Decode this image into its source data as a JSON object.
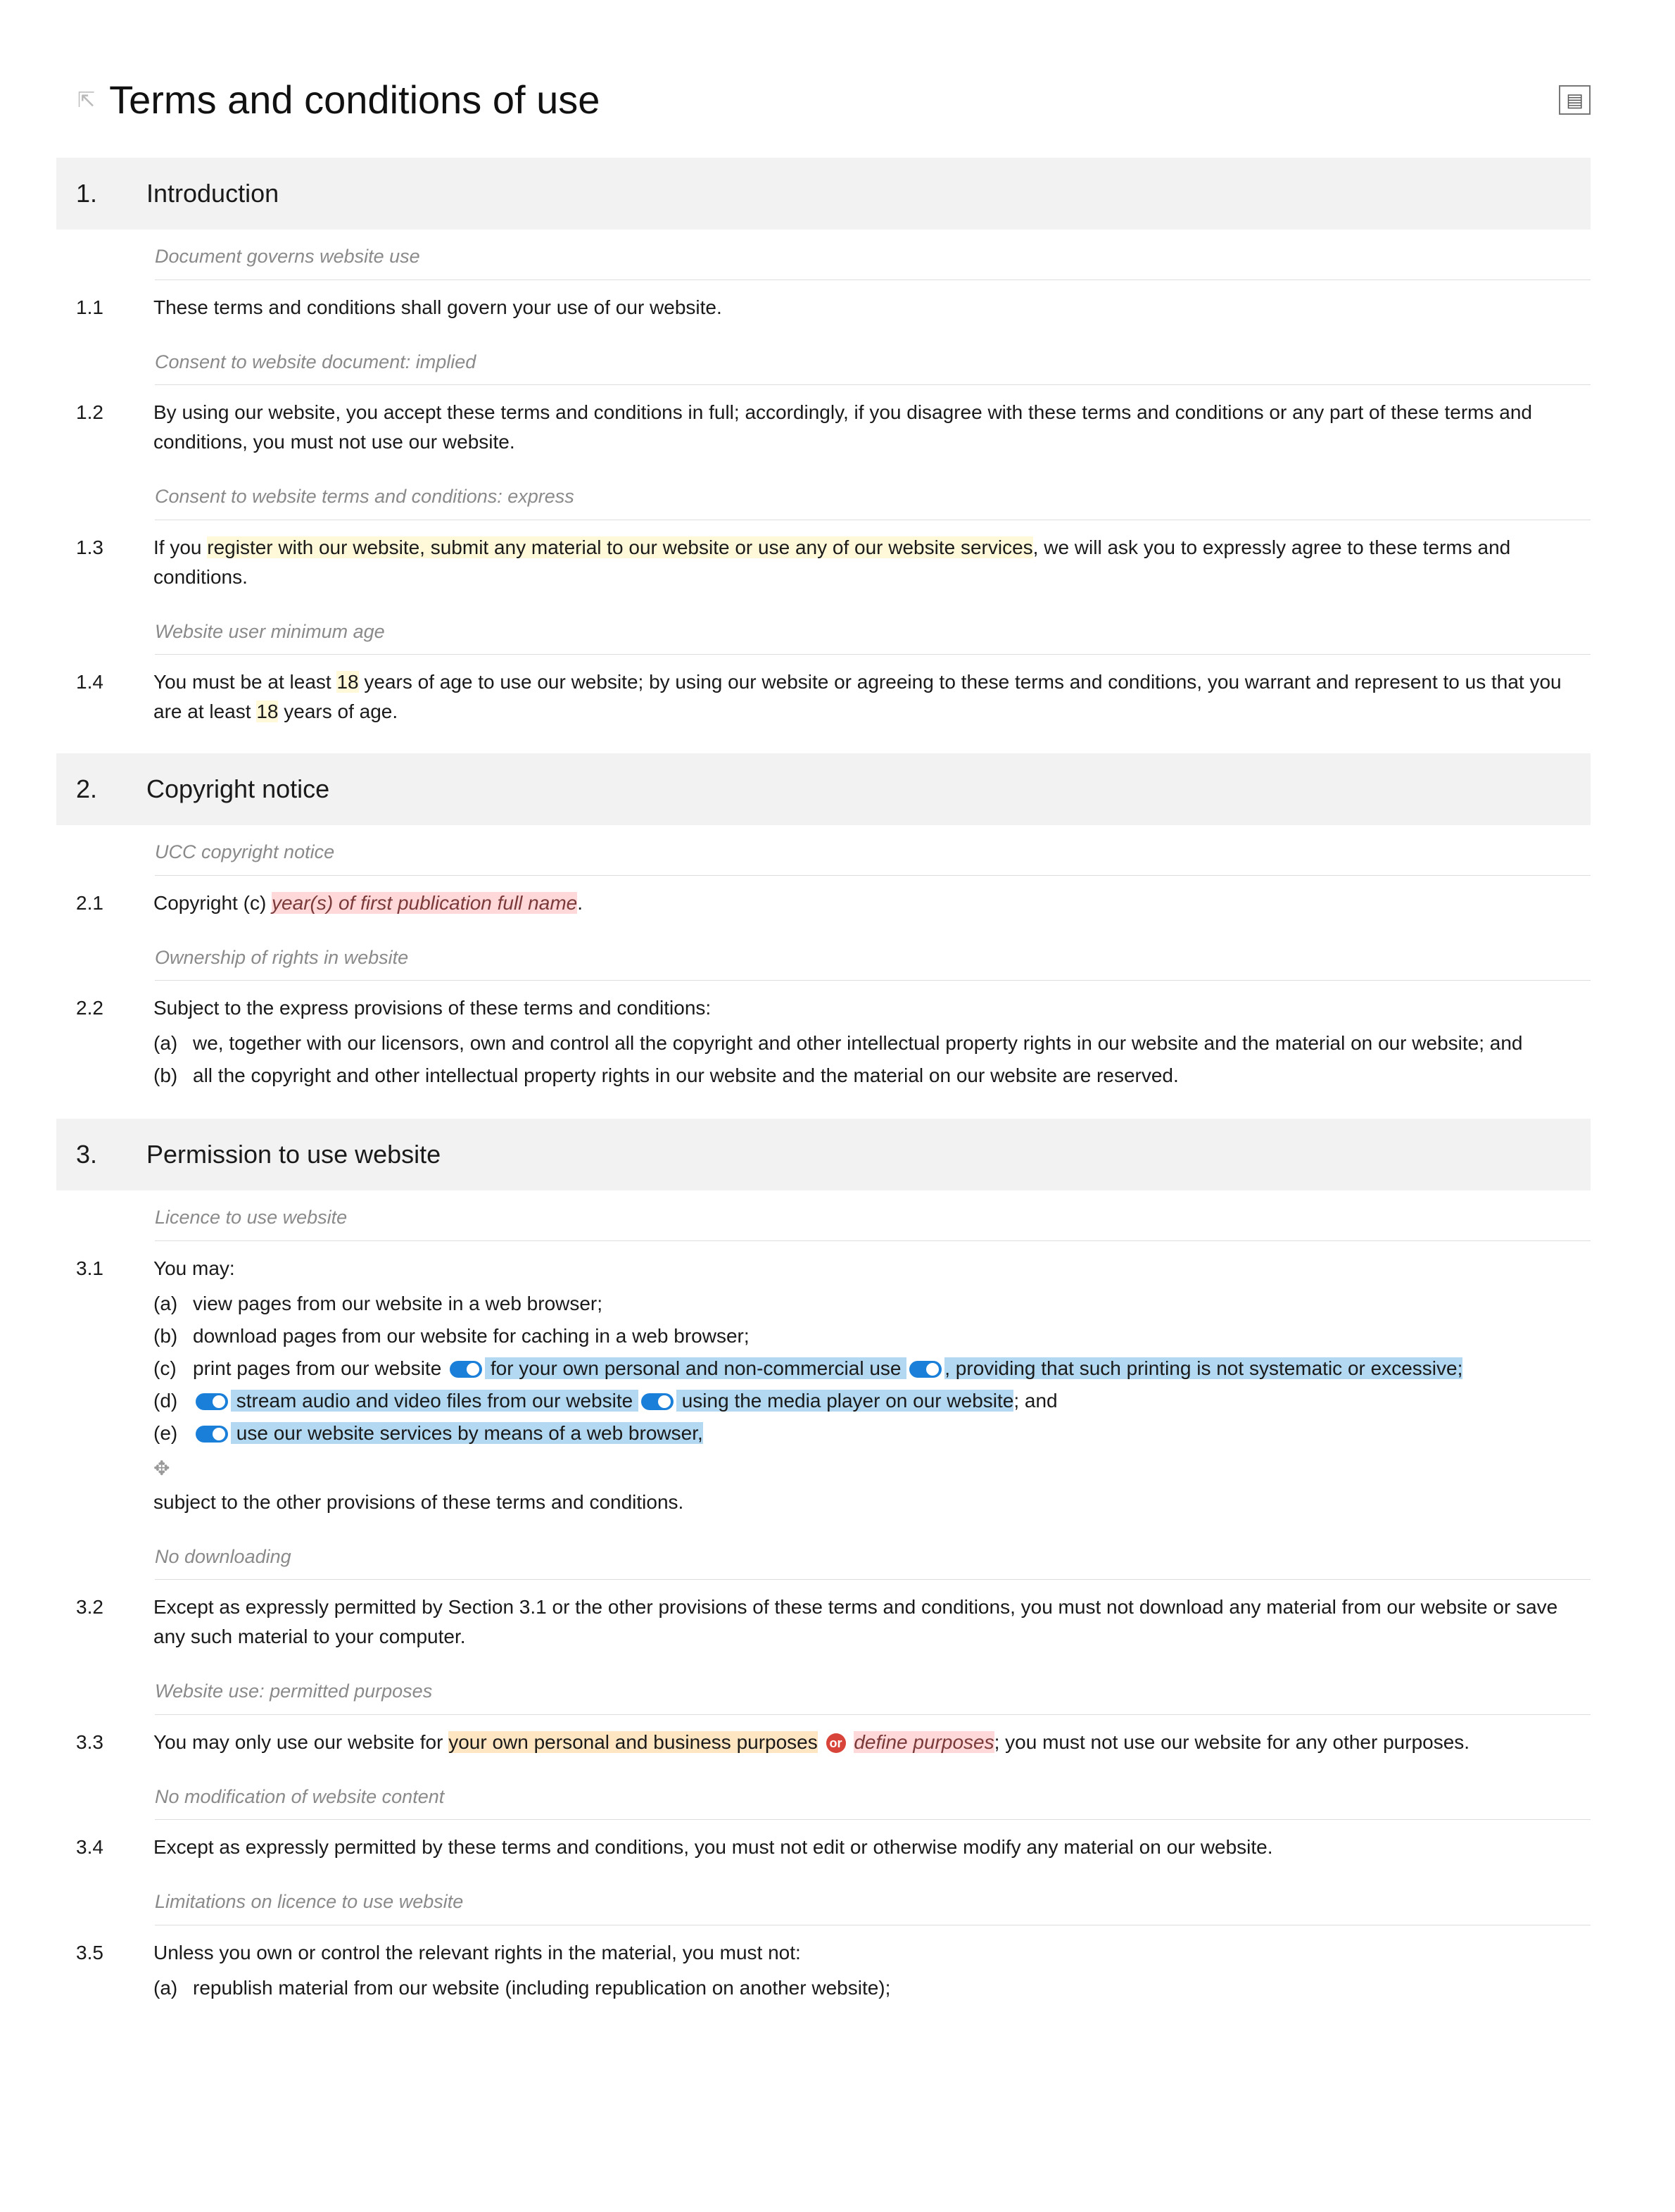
{
  "title": "Terms and conditions of use",
  "sections": [
    {
      "num": "1.",
      "title": "Introduction",
      "clauses": [
        {
          "annotation": "Document governs website use",
          "num": "1.1",
          "body_plain": "These terms and conditions shall govern your use of our website."
        },
        {
          "annotation": "Consent to website document: implied",
          "num": "1.2",
          "body_plain": "By using our website, you accept these terms and conditions in full; accordingly, if you disagree with these terms and conditions or any part of these terms and conditions, you must not use our website."
        },
        {
          "annotation": "Consent to website terms and conditions: express",
          "num": "1.3",
          "pre": "If you ",
          "hl_yellow": "register with our website, submit any material to our website or use any of our website services",
          "post": ", we will ask you to expressly agree to these terms and conditions."
        },
        {
          "annotation": "Website user minimum age",
          "num": "1.4",
          "pre2": "You must be at least ",
          "hl_yellow2": "18",
          "mid2": " years of age to use our website; by using our website or agreeing to these terms and conditions, you warrant and represent to us that you are at least ",
          "hl_yellow3": "18",
          "post2": " years of age."
        }
      ]
    },
    {
      "num": "2.",
      "title": "Copyright notice",
      "clauses": [
        {
          "annotation": "UCC copyright notice",
          "num": "2.1",
          "pre": "Copyright (c) ",
          "hl_pink": "year(s) of first publication full name",
          "post": "."
        },
        {
          "annotation": "Ownership of rights in website",
          "num": "2.2",
          "body_plain": "Subject to the express provisions of these terms and conditions:",
          "subs": [
            {
              "m": "(a)",
              "t": "we, together with our licensors, own and control all the copyright and other intellectual property rights in our website and the material on our website; and"
            },
            {
              "m": "(b)",
              "t": "all the copyright and other intellectual property rights in our website and the material on our website are reserved."
            }
          ]
        }
      ]
    },
    {
      "num": "3.",
      "title": "Permission to use website",
      "clauses": [
        {
          "annotation": "Licence to use website",
          "num": "3.1",
          "body_plain": "You may:",
          "subs_rich": [
            {
              "m": "(a)",
              "plain": "view pages from our website in a web browser;"
            },
            {
              "m": "(b)",
              "plain": "download pages from our website for caching in a web browser;"
            },
            {
              "m": "(c)",
              "pre": "print pages from our website ",
              "toggle1": true,
              "blue1": " for your own personal and non-commercial use ",
              "toggle2": true,
              "blue2": ", providing that such printing is not systematic or excessive;"
            },
            {
              "m": "(d)",
              "toggle_lead": true,
              "blue1": " stream audio and video files from our website ",
              "toggle2": true,
              "blue2": " using the media player on our website",
              "post": "; and"
            },
            {
              "m": "(e)",
              "toggle_lead": true,
              "blue1": " use our website services by means of a web browser,"
            }
          ],
          "add_icon": "✥",
          "tail": "subject to the other provisions of these terms and conditions."
        },
        {
          "annotation": "No downloading",
          "num": "3.2",
          "body_plain": "Except as expressly permitted by Section 3.1 or the other provisions of these terms and conditions, you must not download any material from our website or save any such material to your computer."
        },
        {
          "annotation": "Website use: permitted purposes",
          "num": "3.3",
          "pre": "You may only use our website for ",
          "hl_orange": "your own personal and business purposes",
          "or_badge": "or",
          "hl_pink": "define purposes",
          "post": "; you must not use our website for any other purposes."
        },
        {
          "annotation": "No modification of website content",
          "num": "3.4",
          "body_plain": "Except as expressly permitted by these terms and conditions, you must not edit or otherwise modify any material on our website."
        },
        {
          "annotation": "Limitations on licence to use website",
          "num": "3.5",
          "body_plain": "Unless you own or control the relevant rights in the material, you must not:",
          "subs": [
            {
              "m": "(a)",
              "t": "republish material from our website (including republication on another website);"
            }
          ]
        }
      ]
    }
  ]
}
